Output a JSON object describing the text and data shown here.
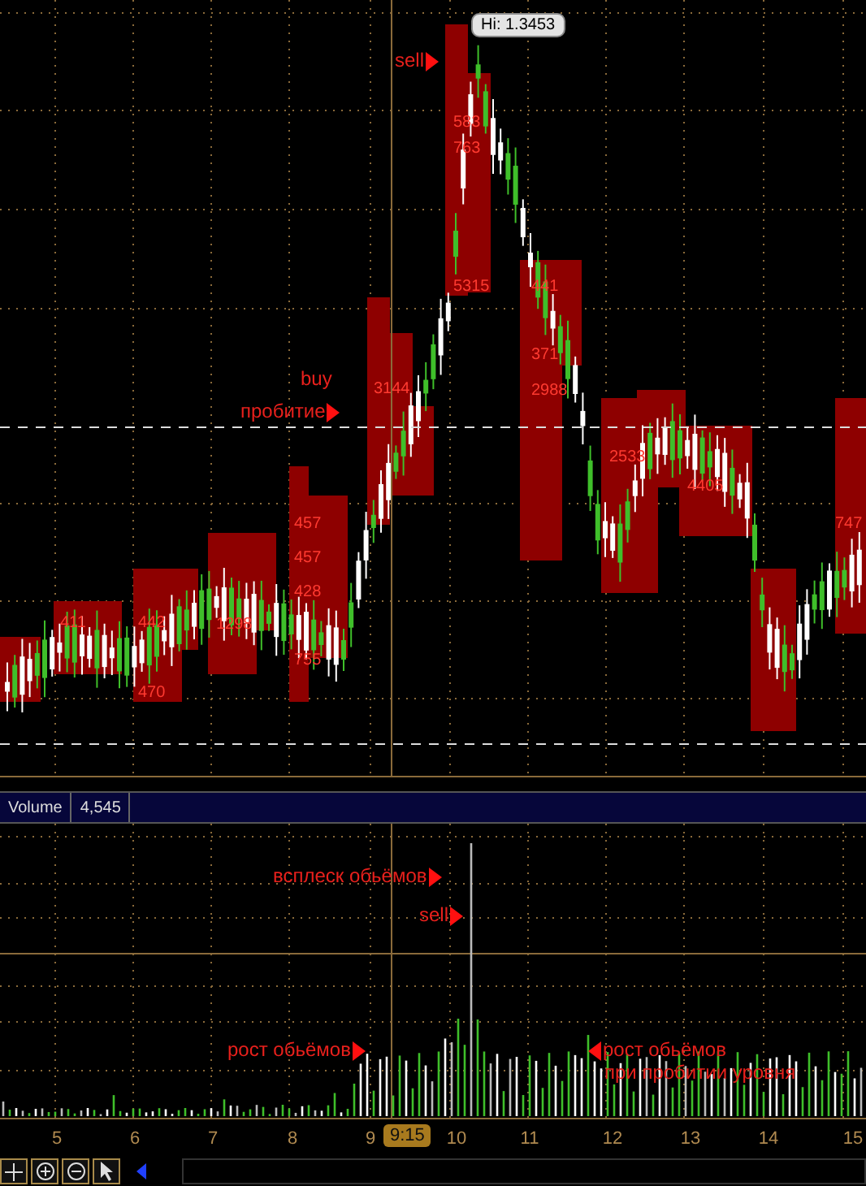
{
  "price_pane": {
    "tooltip": "Hi: 1.3453",
    "annotations": [
      {
        "text": "sell",
        "kind": "right"
      },
      {
        "text": "buy",
        "kind": "plain"
      },
      {
        "text": "пробитие",
        "kind": "right"
      }
    ],
    "profile_labels": [
      "583",
      "763",
      "5315",
      "441",
      "371",
      "2988",
      "3144",
      "457",
      "457",
      "428",
      "755",
      "411",
      "442",
      "470",
      "1298",
      "2533",
      "4405",
      "747"
    ]
  },
  "volume_pane": {
    "title": "Volume",
    "value": "4,545",
    "annotations": [
      {
        "text": "всплеск обьёмов",
        "kind": "right"
      },
      {
        "text": "sell",
        "kind": "right"
      },
      {
        "text": "рост обьёмов",
        "kind": "right"
      },
      {
        "text": "рост обьёмов",
        "kind": "left"
      },
      {
        "text": "при пробитии уровня",
        "kind": "plain"
      }
    ]
  },
  "time_axis": {
    "labels": [
      "5",
      "6",
      "7",
      "8",
      "9",
      "10",
      "11",
      "12",
      "13",
      "14",
      "15"
    ],
    "cursor_label": "9:15"
  }
}
